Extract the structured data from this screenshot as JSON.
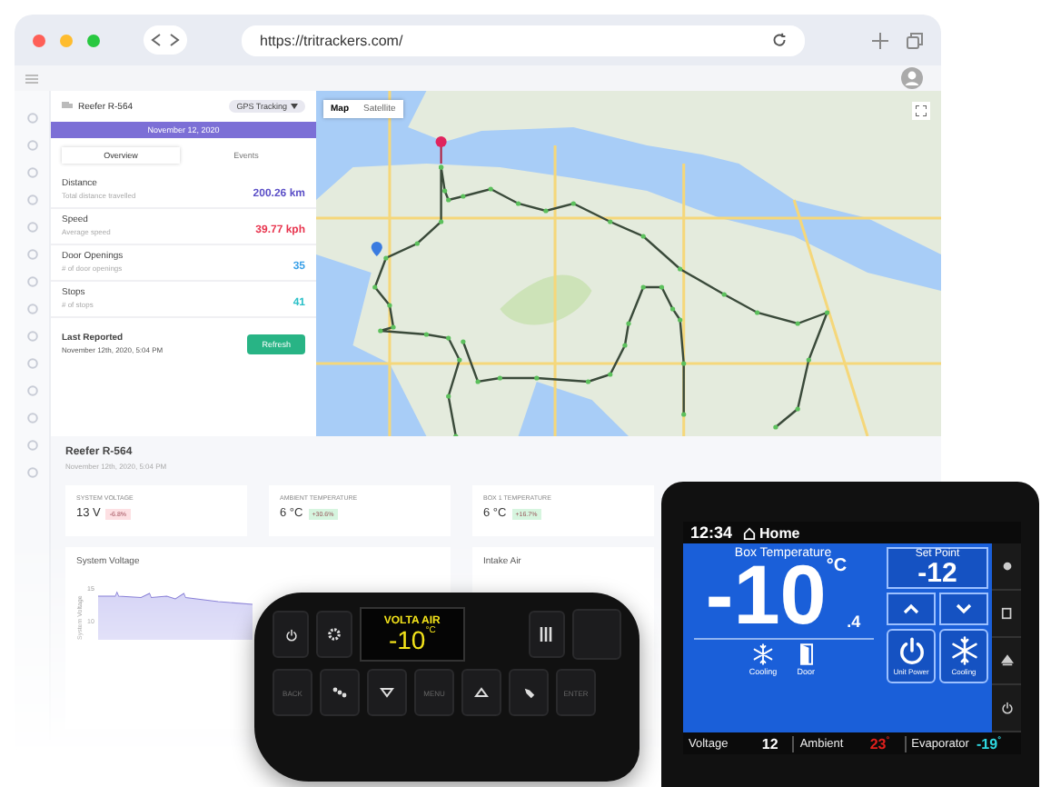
{
  "browser": {
    "url": "https://tritrackers.com/"
  },
  "tracker_panel": {
    "title": "Reefer R-564",
    "mode_select": "GPS Tracking",
    "date": "November 12, 2020",
    "tabs": [
      {
        "label": "Overview",
        "selected": true
      },
      {
        "label": "Events",
        "selected": false
      }
    ],
    "stats": [
      {
        "label": "Distance",
        "sublabel": "Total distance travelled",
        "value": "200.26 km",
        "color": "#5b4fc7"
      },
      {
        "label": "Speed",
        "sublabel": "Average speed",
        "value": "39.77 kph",
        "color": "#e8344e"
      },
      {
        "label": "Door Openings",
        "sublabel": "# of door openings",
        "value": "35",
        "color": "#3aa0e8"
      },
      {
        "label": "Stops",
        "sublabel": "# of stops",
        "value": "41",
        "color": "#2bc0c8"
      }
    ],
    "last_reported": {
      "label": "Last Reported",
      "value": "November 12th, 2020, 5:04 PM"
    },
    "refresh_button": "Refresh"
  },
  "map": {
    "tabs": [
      {
        "label": "Map",
        "selected": true
      },
      {
        "label": "Satellite",
        "selected": false
      }
    ]
  },
  "dashboard": {
    "title": "Reefer R-564",
    "subtitle": "November 12th, 2020, 5:04 PM",
    "cards": [
      {
        "label": "SYSTEM VOLTAGE",
        "value": "13 V",
        "change": "-6.8%",
        "color": "#fde0e3"
      },
      {
        "label": "AMBIENT TEMPERATURE",
        "value": "6 °C",
        "change": "+30.6%",
        "color": "#d6f5df"
      },
      {
        "label": "BOX 1 TEMPERATURE",
        "value": "6 °C",
        "change": "+16.7%",
        "color": "#d6f5df"
      }
    ],
    "panels": [
      {
        "title": "System Voltage",
        "ylabel": "System Voltage",
        "ticks": [
          "15",
          "10"
        ]
      },
      {
        "title": "Intake Air"
      }
    ]
  },
  "controller": {
    "brand": "VOLTA AIR",
    "temperature": "-10",
    "unit": "°C",
    "keys": [
      {
        "kind": "text",
        "label": "BACK"
      },
      {
        "kind": "dots"
      },
      {
        "kind": "down"
      },
      {
        "kind": "text",
        "label": "MENU"
      },
      {
        "kind": "up"
      },
      {
        "kind": "wrench"
      },
      {
        "kind": "text",
        "label": "ENTER"
      }
    ]
  },
  "touchscreen": {
    "time": "12:34",
    "home": "Home",
    "box_label": "Box Temperature",
    "box_temp": "-10",
    "box_decimal": ".4",
    "unit": "°C",
    "set_point_label": "Set Point",
    "set_point": "-12",
    "status": [
      {
        "kind": "snowflake",
        "label": "Cooling"
      },
      {
        "kind": "door",
        "label": "Door"
      }
    ],
    "buttons": [
      {
        "kind": "power",
        "label": "Unit Power"
      },
      {
        "kind": "snowflake",
        "label": "Cooling"
      }
    ],
    "readings": [
      {
        "label": "Voltage",
        "value": "12",
        "color": "#ffffff"
      },
      {
        "label": "Ambient",
        "value": "23$^{°}$",
        "color": "#e0201c"
      },
      {
        "label": "Evaporator",
        "value": "-19$^{°}$",
        "color": "#2fd8e0"
      }
    ]
  }
}
